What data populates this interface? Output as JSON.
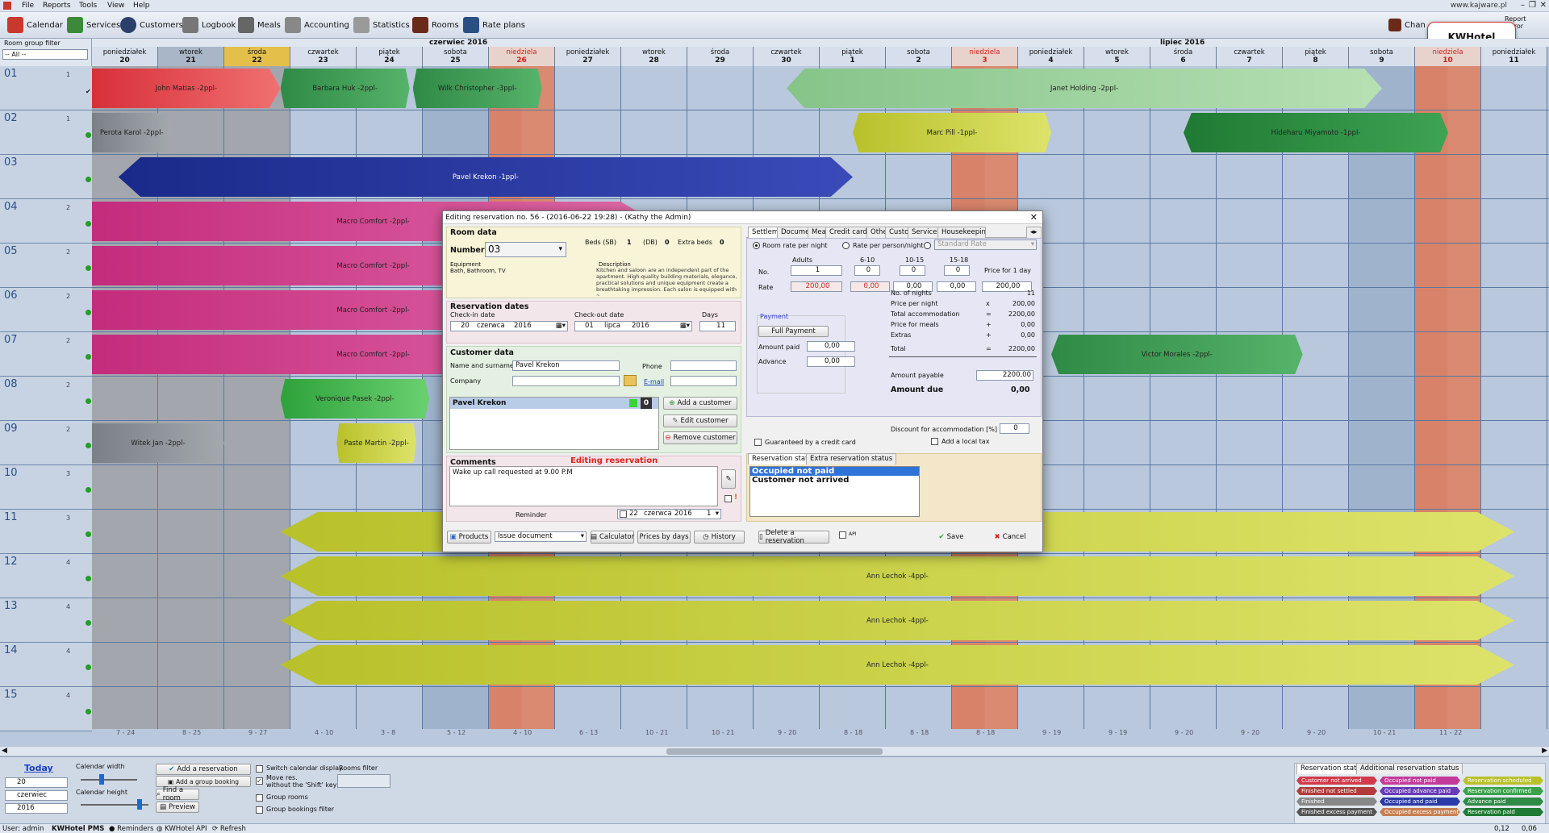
{
  "menu": [
    "File",
    "Reports",
    "Tools",
    "View",
    "Help"
  ],
  "window_link": "www.kajware.pl",
  "toolbar": [
    {
      "label": "Calendar",
      "icon": "calendar-icon",
      "color": "#c8382c"
    },
    {
      "label": "Services",
      "icon": "services-icon",
      "color": "#3a8a3a"
    },
    {
      "label": "Customers",
      "icon": "customers-icon",
      "color": "#2a3f6a"
    },
    {
      "label": "Logbook",
      "icon": "logbook-icon",
      "color": "#777"
    },
    {
      "label": "Meals",
      "icon": "meals-icon",
      "color": "#666"
    },
    {
      "label": "Accounting",
      "icon": "accounting-icon",
      "color": "#888"
    },
    {
      "label": "Statistics",
      "icon": "statistics-icon",
      "color": "#9a9a9a"
    },
    {
      "label": "Rooms",
      "icon": "rooms-icon",
      "color": "#6a2a1a"
    },
    {
      "label": "Rate plans",
      "icon": "rate-plans-icon",
      "color": "#2a4f84"
    }
  ],
  "toolbar_right": {
    "change_label": "Chan",
    "report_label": "Report",
    "error_label": "Error"
  },
  "logo_label": "KWHotel",
  "room_filter": {
    "label": "Room group filter",
    "value": "-- All --"
  },
  "months": {
    "june": "czerwiec 2016",
    "july": "lipiec 2016"
  },
  "days": [
    {
      "d": "poniedziałek",
      "n": "20",
      "t": "n"
    },
    {
      "d": "wtorek",
      "n": "21",
      "t": "g"
    },
    {
      "d": "środa",
      "n": "22",
      "t": "y"
    },
    {
      "d": "czwartek",
      "n": "23",
      "t": "n"
    },
    {
      "d": "piątek",
      "n": "24",
      "t": "n"
    },
    {
      "d": "sobota",
      "n": "25",
      "t": "n"
    },
    {
      "d": "niedziela",
      "n": "26",
      "t": "s"
    },
    {
      "d": "poniedziałek",
      "n": "27",
      "t": "n"
    },
    {
      "d": "wtorek",
      "n": "28",
      "t": "n"
    },
    {
      "d": "środa",
      "n": "29",
      "t": "n"
    },
    {
      "d": "czwartek",
      "n": "30",
      "t": "n"
    },
    {
      "d": "piątek",
      "n": "1",
      "t": "n"
    },
    {
      "d": "sobota",
      "n": "2",
      "t": "n"
    },
    {
      "d": "niedziela",
      "n": "3",
      "t": "s"
    },
    {
      "d": "poniedziałek",
      "n": "4",
      "t": "n"
    },
    {
      "d": "wtorek",
      "n": "5",
      "t": "n"
    },
    {
      "d": "środa",
      "n": "6",
      "t": "n"
    },
    {
      "d": "czwartek",
      "n": "7",
      "t": "n"
    },
    {
      "d": "piątek",
      "n": "8",
      "t": "n"
    },
    {
      "d": "sobota",
      "n": "9",
      "t": "n"
    },
    {
      "d": "niedziela",
      "n": "10",
      "t": "s"
    },
    {
      "d": "poniedziałek",
      "n": "11",
      "t": "n"
    }
  ],
  "rooms": [
    {
      "num": "01",
      "cap": "1"
    },
    {
      "num": "02",
      "cap": "1"
    },
    {
      "num": "03",
      "cap": ""
    },
    {
      "num": "04",
      "cap": "2"
    },
    {
      "num": "05",
      "cap": "2"
    },
    {
      "num": "06",
      "cap": "2"
    },
    {
      "num": "07",
      "cap": "2"
    },
    {
      "num": "08",
      "cap": "2"
    },
    {
      "num": "09",
      "cap": "2"
    },
    {
      "num": "10",
      "cap": "3"
    },
    {
      "num": "11",
      "cap": "3"
    },
    {
      "num": "12",
      "cap": "4"
    },
    {
      "num": "13",
      "cap": "4"
    },
    {
      "num": "14",
      "cap": "4"
    },
    {
      "num": "15",
      "cap": "4"
    }
  ],
  "bookings": [
    {
      "label": "John Matias -2ppl-",
      "color": "#d8303a",
      "color2": "#f07070"
    },
    {
      "label": "Barbara Huk -2ppl-",
      "color": "#2f8a45",
      "color2": "#56b36a"
    },
    {
      "label": "Wilk Christopher -3ppl-",
      "color": "#2f8a45",
      "color2": "#56b36a"
    },
    {
      "label": "Janet Holding -2ppl-",
      "color": "#86c48a",
      "color2": "#b7e0b3"
    },
    {
      "label": "Perota Karol -2ppl-",
      "color": "#7b8087",
      "color2": "#a4a9ae"
    },
    {
      "label": "Marc Pill -1ppl-",
      "color": "#b8c12a",
      "color2": "#dde36a"
    },
    {
      "label": "Hideharu Miyamoto -1ppl-",
      "color": "#1f7a33",
      "color2": "#3ea352"
    },
    {
      "label": "Pavel Krekon -1ppl-",
      "color": "#1a2a8a",
      "color2": "#3a4ab8"
    },
    {
      "label": "Macro Comfort -2ppl-",
      "color": "#c42b7c",
      "color2": "#e06aa8"
    },
    {
      "label": "Macro Comfort -2ppl-",
      "color": "#c42b7c",
      "color2": "#e06aa8"
    },
    {
      "label": "Macro Comfort -2ppl-",
      "color": "#c42b7c",
      "color2": "#e06aa8"
    },
    {
      "label": "Macro Comfort -2ppl-",
      "color": "#c42b7c",
      "color2": "#e06aa8"
    },
    {
      "label": "Victor Morales -2ppl-",
      "color": "#2f8a45",
      "color2": "#56b36a"
    },
    {
      "label": "Veronique Pasek -2ppl-",
      "color": "#2ea23a",
      "color2": "#6ad070"
    },
    {
      "label": "Witek Jan -2ppl-",
      "color": "#7b8087",
      "color2": "#a4a9ae"
    },
    {
      "label": "Paste Martin -2ppl-",
      "color": "#b8c12a",
      "color2": "#dde36a"
    },
    {
      "label": "",
      "color": "#b8c12a",
      "color2": "#dde36a"
    },
    {
      "label": "Ann Lechok -4ppl-",
      "color": "#b8c12a",
      "color2": "#dde36a"
    },
    {
      "label": "Ann Lechok -4ppl-",
      "color": "#b8c12a",
      "color2": "#dde36a"
    },
    {
      "label": "Ann Lechok -4ppl-",
      "color": "#b8c12a",
      "color2": "#dde36a"
    }
  ],
  "week_labels": [
    "7 - 24",
    "8 - 25",
    "9 - 27",
    "4 - 10",
    "3 - 8",
    "5 - 12",
    "4 - 10",
    "6 - 13",
    "10 - 21",
    "10 - 21",
    "9 - 20",
    "8 - 18",
    "8 - 18",
    "8 - 18",
    "9 - 19",
    "9 - 19",
    "9 - 20",
    "9 - 20",
    "9 - 20",
    "10 - 21",
    "11 - 22"
  ],
  "dialog": {
    "title": "Editing reservation no. 56 - (2016-06-22 19:28) - (Kathy the Admin)",
    "room_data": "Room data",
    "number_label": "Number",
    "number_value": "03",
    "beds_sb_label": "Beds (SB)",
    "beds_sb": "1",
    "db_label": "(DB)",
    "db": "0",
    "extra_beds_label": "Extra beds",
    "extra_beds": "0",
    "equipment_label": "Equipment",
    "equipment": "Bath, Bathroom, TV",
    "description_label": "Description",
    "description": "Kitchen and saloon are an independent part of the apartment. High-quality building materials, elegance, practical solutions and unique equipment create a breathtaking impression. Each salon is equipped with a",
    "reservation_dates": "Reservation dates",
    "checkin_label": "Check-in date",
    "checkin_day": "20",
    "checkin_month": "czerwca",
    "checkin_year": "2016",
    "checkout_label": "Check-out date",
    "checkout_day": "01",
    "checkout_month": "lipca",
    "checkout_year": "2016",
    "days_label": "Days",
    "days_value": "11",
    "customer_data": "Customer data",
    "name_label": "Name and surname",
    "name_value": "Pavel Krekon",
    "phone_label": "Phone",
    "company_label": "Company",
    "email_label": "E-mail",
    "customer_list_item": "Pavel Krekon",
    "customer_count": "0",
    "add_customer": "Add a customer",
    "edit_customer": "Edit customer",
    "remove_customer": "Remove customer",
    "comments_label": "Comments",
    "editing_label": "Editing reservation",
    "comment_text": "Wake up call requested at 9.00 P.M",
    "reminder_label": "Reminder",
    "reminder_day": "22",
    "reminder_month": "czerwca",
    "reminder_year": "2016",
    "reminder_num": "1",
    "tabs": [
      "Settlement",
      "Documents",
      "Meals",
      "Credit card",
      "Other",
      "Custom",
      "Services",
      "Housekeeping ca"
    ],
    "rate_room": "Room rate per night",
    "rate_person": "Rate per person/night",
    "rate_plan": "Standard Rate",
    "col_adults": "Adults",
    "col_610": "6-10",
    "col_1015": "10-15",
    "col_1518": "15-18",
    "price_for_day": "Price for 1 day",
    "no_label": "No.",
    "rate_label": "Rate",
    "no_values": [
      "1",
      "0",
      "0",
      "0"
    ],
    "rate_values": [
      "200,00",
      "0,00",
      "0,00",
      "0,00",
      "200,00"
    ],
    "payment_label": "Payment",
    "full_payment": "Full Payment",
    "amount_paid_label": "Amount paid",
    "amount_paid": "0,00",
    "advance_label": "Advance",
    "advance": "0,00",
    "summary": [
      {
        "l": "No. of nights",
        "op": "",
        "v": "11"
      },
      {
        "l": "Price per night",
        "op": "x",
        "v": "200,00"
      },
      {
        "l": "Total accommodation",
        "op": "=",
        "v": "2200,00"
      },
      {
        "l": "Price for meals",
        "op": "+",
        "v": "0,00"
      },
      {
        "l": "Extras",
        "op": "+",
        "v": "0,00"
      },
      {
        "l": "Total",
        "op": "=",
        "v": "2200,00"
      }
    ],
    "amount_payable_label": "Amount payable",
    "amount_payable": "2200,00",
    "amount_due_label": "Amount due",
    "amount_due": "0,00",
    "guaranteed_label": "Guaranteed by a credit card",
    "discount_label": "Discount for accommodation [%]",
    "discount": "0",
    "local_tax_label": "Add a local tax",
    "status_tab": "Reservation status",
    "extra_status_tab": "Extra reservation status",
    "status_options": [
      "Occupied not paid",
      "Customer not arrived"
    ],
    "btn_products": "Products",
    "btn_issue": "Issue document",
    "btn_calculator": "Calculator",
    "btn_prices": "Prices by days",
    "btn_history": "History",
    "btn_delete": "Delete a reservation",
    "api_label": "API",
    "btn_save": "Save",
    "btn_cancel": "Cancel"
  },
  "bottom": {
    "today": "Today",
    "calendar_width": "Calendar width",
    "calendar_height": "Calendar height",
    "day": "20",
    "month": "czerwiec",
    "year": "2016",
    "add_reservation": "Add a reservation",
    "add_group_booking": "Add a group booking",
    "find_room": "Find a room",
    "preview": "Preview",
    "switch_display": "Switch calendar display",
    "move_res": "Move res.",
    "without_shift": "without the 'Shift' key",
    "group_rooms": "Group rooms",
    "group_bookings_filter": "Group bookings filter",
    "rooms_filter": "Rooms filter",
    "legend_tab1": "Reservation status",
    "legend_tab2": "Additional reservation status",
    "legend": [
      {
        "l": "Customer not arrived",
        "c": "#d23a4a"
      },
      {
        "l": "Occupied not paid",
        "c": "#c43a9a"
      },
      {
        "l": "Reservation scheduled",
        "c": "#b8c12a"
      },
      {
        "l": "Finished not settled",
        "c": "#b23a3a"
      },
      {
        "l": "Occupied advance paid",
        "c": "#6a3ab8"
      },
      {
        "l": "Reservation confirmed",
        "c": "#3aa34a"
      },
      {
        "l": "Finished",
        "c": "#888"
      },
      {
        "l": "Occupied and paid",
        "c": "#2a3aa8"
      },
      {
        "l": "Advance paid",
        "c": "#2f8a45"
      },
      {
        "l": "Finished excess payment",
        "c": "#555"
      },
      {
        "l": "Occupied excess payment",
        "c": "#c88050"
      },
      {
        "l": "Reservation paid",
        "c": "#1f7a33"
      }
    ]
  },
  "status": {
    "user": "User: admin",
    "app": "KWHotel PMS",
    "reminders": "Reminders",
    "api": "KWHotel API",
    "refresh": "Refresh",
    "coords": "0,12",
    "coords2": "0,06"
  }
}
